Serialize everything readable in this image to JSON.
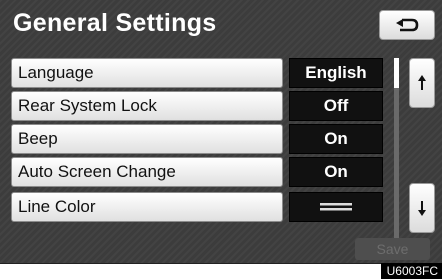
{
  "header": {
    "title": "General Settings",
    "back_icon": "return-arrow-icon"
  },
  "settings": [
    {
      "label": "Language",
      "value": "English"
    },
    {
      "label": "Rear System Lock",
      "value": "Off"
    },
    {
      "label": "Beep",
      "value": "On"
    },
    {
      "label": "Auto Screen Change",
      "value": "On"
    },
    {
      "label": "Line Color",
      "value": "",
      "value_icon": "line-color-swatch"
    }
  ],
  "scroll": {
    "up_icon": "scroll-up-icon",
    "down_icon": "scroll-down-icon"
  },
  "footer": {
    "save_label": "Save",
    "image_code": "U6003FC"
  },
  "colors": {
    "background": "#3c3c3c",
    "value_bg": "#111111",
    "button_bg": "#f2f2f2",
    "save_disabled": "#6d6d6d"
  }
}
